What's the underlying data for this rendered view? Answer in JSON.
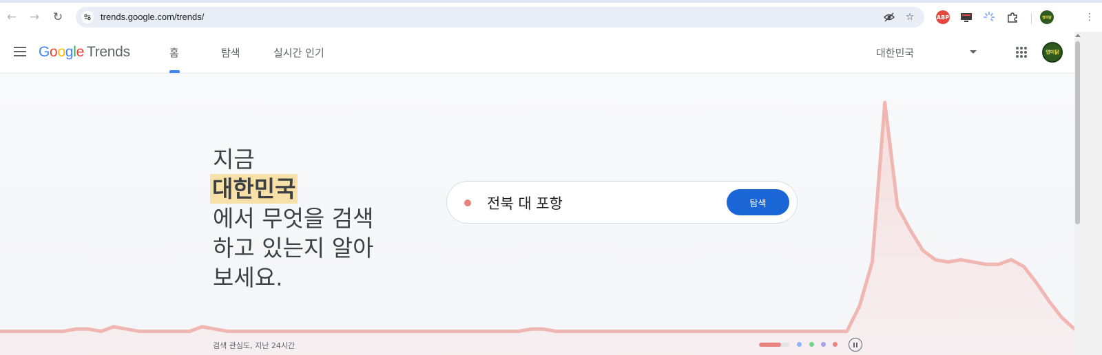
{
  "browser": {
    "url": "trends.google.com/trends/",
    "back_icon": "arrow-left-icon",
    "forward_icon": "arrow-right-icon",
    "reload_icon": "reload-icon",
    "extensions": [
      {
        "name": "abp-extension-icon",
        "text": "ABP",
        "color": "#e4473e"
      },
      {
        "name": "screen-extension-icon",
        "text": "",
        "color": "#3c3c3c"
      },
      {
        "name": "loading-extension-icon",
        "text": "",
        "color": "#8ab4f8"
      },
      {
        "name": "puzzle-extension-icon",
        "text": "",
        "color": "#5f6368"
      }
    ]
  },
  "header": {
    "logo_google": "Google",
    "logo_product": "Trends",
    "tabs": [
      {
        "label": "홈",
        "active": true
      },
      {
        "label": "탐색",
        "active": false
      },
      {
        "label": "실시간 인기",
        "active": false
      }
    ],
    "region": "대한민국",
    "avatar_text": "영미닭"
  },
  "hero": {
    "line1": "지금",
    "highlight": "대한민국",
    "line3": "에서 무엇을 검색",
    "line4": "하고 있는지 알아",
    "line5": "보세요.",
    "search_term": "전북 대 포항",
    "search_button": "탐색",
    "caption": "검색 관심도, 지난 24시간",
    "accent_color": "#e8837e",
    "button_color": "#1a66d6",
    "highlight_color": "#f7e1a8"
  },
  "carousel": {
    "dots": [
      {
        "name": "carousel-dot-2",
        "color": "#8ab4f8"
      },
      {
        "name": "carousel-dot-3",
        "color": "#6dd58c"
      },
      {
        "name": "carousel-dot-4",
        "color": "#a8a0e6"
      },
      {
        "name": "carousel-dot-5",
        "color": "#e8837e"
      }
    ],
    "active_index": 0
  },
  "chart_data": {
    "type": "area",
    "title": "",
    "xlabel": "",
    "ylabel": "",
    "ylim": [
      0,
      100
    ],
    "color": "#e8837e",
    "series": [
      {
        "values": [
          1,
          1,
          1,
          1,
          1,
          1,
          2,
          2,
          1,
          3,
          2,
          1,
          1,
          1,
          1,
          1,
          3,
          2,
          1,
          1,
          1,
          1,
          1,
          1,
          1,
          1,
          1,
          1,
          1,
          1,
          1,
          1,
          1,
          1,
          1,
          1,
          1,
          1,
          1,
          1,
          1,
          1,
          2,
          2,
          1,
          1,
          1,
          1,
          1,
          1,
          1,
          1,
          1,
          1,
          1,
          1,
          1,
          1,
          1,
          1,
          1,
          1,
          1,
          1,
          1,
          1,
          1,
          1,
          12,
          31,
          100,
          55,
          45,
          36,
          32,
          31,
          32,
          31,
          30,
          30,
          32,
          29,
          22,
          14,
          7,
          2
        ]
      }
    ]
  }
}
